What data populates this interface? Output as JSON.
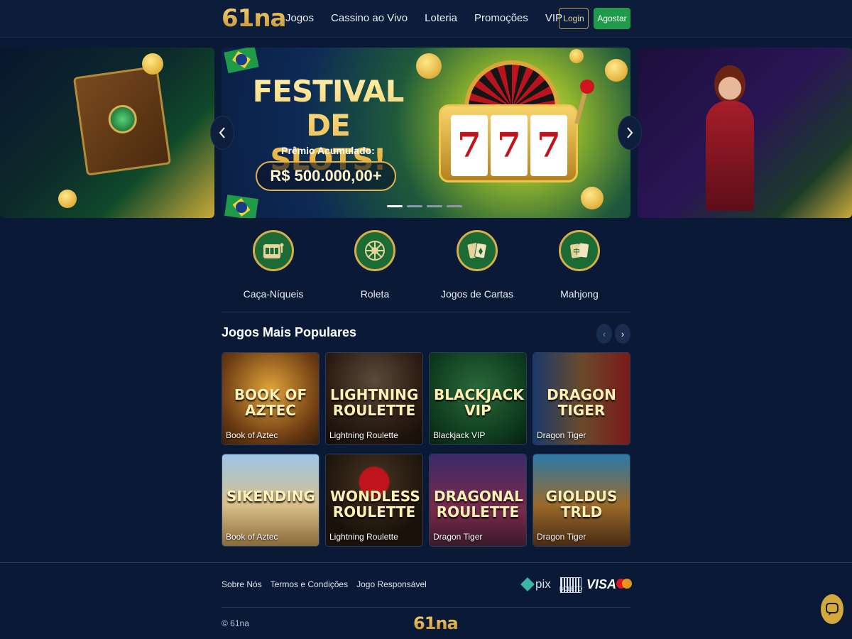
{
  "header": {
    "logo": "61na",
    "nav": [
      "Jogos",
      "Cassino ao Vivo",
      "Loteria",
      "Promoções",
      "VIP"
    ],
    "login_label": "Login",
    "register_label": "Agostar"
  },
  "banner": {
    "title_line1": "FESTIVAL",
    "title_line2": "DE SLOTS!",
    "subtitle": "Prêmio Acumulado:",
    "prize": "R$ 500.000,00+",
    "reel_1": "7",
    "reel_2": "7",
    "reel_3": "7",
    "prev_icon": "chevron-left-icon",
    "next_icon": "chevron-right-icon",
    "slide_count": 4,
    "active_slide": 1
  },
  "categories": [
    {
      "label": "Caça-Níqueis",
      "icon": "slot-machine-icon"
    },
    {
      "label": "Roleta",
      "icon": "roulette-icon"
    },
    {
      "label": "Jogos de Cartas",
      "icon": "cards-icon"
    },
    {
      "label": "Mahjong",
      "icon": "mahjong-icon"
    }
  ],
  "popular": {
    "title": "Jogos Mais Populares",
    "prev_arrow": "‹",
    "next_arrow": "›",
    "games": [
      {
        "art": "BOOK OF AZTEC",
        "name": "Book of Aztec"
      },
      {
        "art": "LIGHTNING ROULETTE",
        "name": "Lightning Roulette"
      },
      {
        "art": "BLACKJACK VIP",
        "name": "Blackjack VIP"
      },
      {
        "art": "DRAGON TIGER",
        "name": "Dragon Tiger"
      },
      {
        "art": "SIKENDING",
        "name": "Book of Aztec"
      },
      {
        "art": "WONDLESS ROULETTE",
        "name": "Lightning Roulette"
      },
      {
        "art": "DRAGONAL ROULETTE",
        "name": "Dragon Tiger"
      },
      {
        "art": "GIOLDUS TRLD",
        "name": "Dragon Tiger"
      }
    ]
  },
  "footer": {
    "links": [
      "Sobre Nós",
      "Termos e Condições",
      "Jogo Responsável"
    ],
    "payments": {
      "pix": "pix",
      "boleto": "BOLETO",
      "visa": "VISA",
      "mastercard_icon": "mastercard-icon"
    },
    "copyright": "© 61na",
    "logo": "61na"
  },
  "chat_icon": "chat-icon",
  "colors": {
    "background": "#0a1a36",
    "accent_gold": "#d4ae4d",
    "accent_green": "#1f9a49"
  }
}
